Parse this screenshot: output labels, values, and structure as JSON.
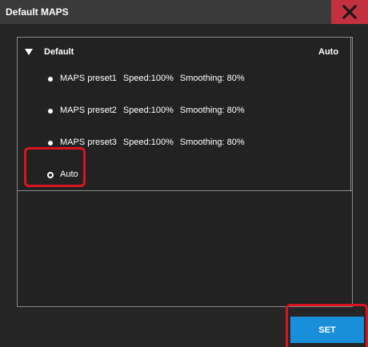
{
  "window": {
    "title": "Default MAPS",
    "close_icon": "close-icon"
  },
  "group": {
    "label": "Default",
    "value": "Auto",
    "expand_icon": "triangle-down-icon"
  },
  "options": [
    {
      "name": "MAPS preset1",
      "speed": "Speed:100%",
      "smoothing": "Smoothing: 80%",
      "selected": false
    },
    {
      "name": "MAPS preset2",
      "speed": "Speed:100%",
      "smoothing": "Smoothing: 80%",
      "selected": false
    },
    {
      "name": "MAPS preset3",
      "speed": "Speed:100%",
      "smoothing": "Smoothing: 80%",
      "selected": false
    },
    {
      "name": "Auto",
      "speed": "",
      "smoothing": "",
      "selected": true
    }
  ],
  "actions": {
    "set_label": "SET"
  },
  "colors": {
    "background": "#252525",
    "titlebar": "#3a3a3a",
    "close_bg": "#c3303e",
    "set_button": "#1a8fd9",
    "highlight": "#d8151f"
  }
}
